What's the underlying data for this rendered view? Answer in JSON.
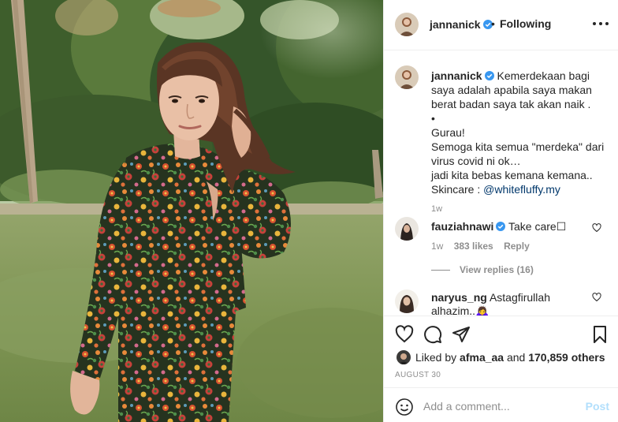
{
  "post": {
    "image_alt": "Woman in floral dress standing on grass",
    "header": {
      "username": "jannanick",
      "separator": "•",
      "follow_status": "Following"
    },
    "caption": {
      "username": "jannanick",
      "lines": [
        "Kemerdekaan bagi",
        "saya adalah apabila saya makan",
        "berat badan saya tak akan naik .",
        "•",
        "Gurau!",
        "Semoga kita semua \"merdeka\" dari",
        "virus covid ni ok…",
        "jadi kita bebas kemana kemana..",
        "Skincare : "
      ],
      "mention": "@whitefluffy.my",
      "time": "1w"
    },
    "comments": [
      {
        "username": "fauziahnawi",
        "text": "Take care",
        "emoji": "☐",
        "time": "1w",
        "likes": "383 likes",
        "reply_label": "Reply",
        "view_replies": "View replies (16)"
      },
      {
        "username": "naryus_ng",
        "text_line1": "Astagfirullah",
        "text_line2": "alhazim..",
        "emoji": "🙇‍♀"
      }
    ],
    "liked_by": {
      "prefix": "Liked by ",
      "user": "afma_aa",
      "middle": " and ",
      "others": "170,859 others"
    },
    "date": "AUGUST 30",
    "add_comment": {
      "placeholder": "Add a comment...",
      "post_label": "Post"
    },
    "colors": {
      "verified": "#3897f0",
      "link": "#00376b",
      "muted": "#8e8e8e",
      "post_disabled": "#b2dffc"
    }
  }
}
